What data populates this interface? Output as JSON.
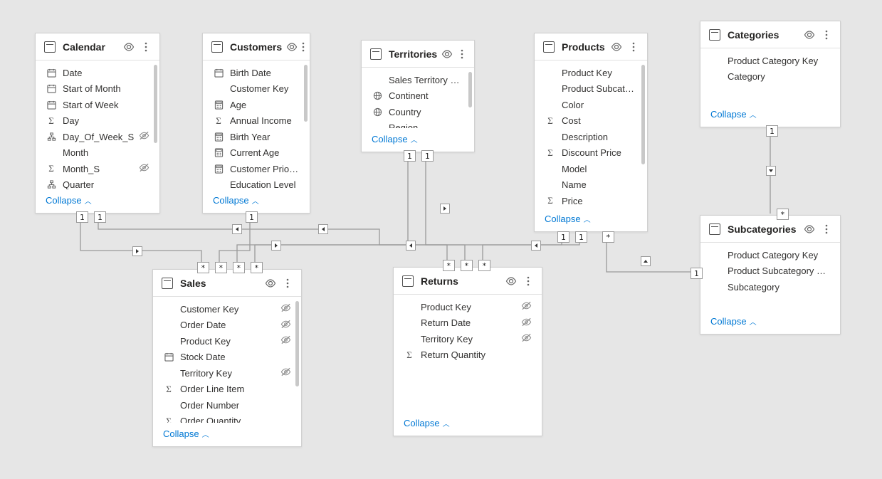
{
  "collapse_label": "Collapse",
  "chart_data": {
    "type": "diagram",
    "description": "Power BI data model relationship view",
    "tables": [
      "Calendar",
      "Customers",
      "Territories",
      "Products",
      "Categories",
      "Sales",
      "Returns",
      "Subcategories"
    ],
    "relationships": [
      {
        "from": "Calendar",
        "to": "Sales",
        "from_card": "1",
        "to_card": "*"
      },
      {
        "from": "Calendar",
        "to": "Returns",
        "from_card": "1",
        "to_card": "*"
      },
      {
        "from": "Customers",
        "to": "Sales",
        "from_card": "1",
        "to_card": "*"
      },
      {
        "from": "Territories",
        "to": "Sales",
        "from_card": "1",
        "to_card": "*"
      },
      {
        "from": "Territories",
        "to": "Returns",
        "from_card": "1",
        "to_card": "*"
      },
      {
        "from": "Products",
        "to": "Sales",
        "from_card": "1",
        "to_card": "*"
      },
      {
        "from": "Products",
        "to": "Returns",
        "from_card": "1",
        "to_card": "*"
      },
      {
        "from": "Categories",
        "to": "Subcategories",
        "from_card": "1",
        "to_card": "*"
      },
      {
        "from": "Subcategories",
        "to": "Products",
        "from_card": "1",
        "to_card": "*"
      }
    ]
  },
  "cards": {
    "calendar": {
      "title": "Calendar",
      "fields": [
        {
          "icon": "calendar",
          "label": "Date"
        },
        {
          "icon": "calendar",
          "label": "Start of Month"
        },
        {
          "icon": "calendar",
          "label": "Start of Week"
        },
        {
          "icon": "sigma",
          "label": "Day"
        },
        {
          "icon": "hier",
          "label": "Day_Of_Week_S",
          "hidden": true
        },
        {
          "icon": "",
          "label": "Month"
        },
        {
          "icon": "sigma",
          "label": "Month_S",
          "hidden": true
        },
        {
          "icon": "hier",
          "label": "Quarter"
        }
      ]
    },
    "customers": {
      "title": "Customers",
      "fields": [
        {
          "icon": "calendar",
          "label": "Birth Date"
        },
        {
          "icon": "",
          "label": "Customer Key"
        },
        {
          "icon": "calc",
          "label": "Age"
        },
        {
          "icon": "sigma",
          "label": "Annual Income"
        },
        {
          "icon": "calc",
          "label": "Birth Year"
        },
        {
          "icon": "calc",
          "label": "Current Age"
        },
        {
          "icon": "calc",
          "label": "Customer Priority"
        },
        {
          "icon": "",
          "label": "Education Level"
        }
      ]
    },
    "territories": {
      "title": "Territories",
      "fields": [
        {
          "icon": "",
          "label": "Sales Territory Key"
        },
        {
          "icon": "globe",
          "label": "Continent"
        },
        {
          "icon": "globe",
          "label": "Country"
        },
        {
          "icon": "",
          "label": "Region"
        }
      ]
    },
    "products": {
      "title": "Products",
      "fields": [
        {
          "icon": "",
          "label": "Product Key"
        },
        {
          "icon": "",
          "label": "Product Subcategor..."
        },
        {
          "icon": "",
          "label": "Color"
        },
        {
          "icon": "sigma",
          "label": "Cost"
        },
        {
          "icon": "",
          "label": "Description"
        },
        {
          "icon": "sigma",
          "label": "Discount Price"
        },
        {
          "icon": "",
          "label": "Model"
        },
        {
          "icon": "",
          "label": "Name"
        },
        {
          "icon": "sigma",
          "label": "Price"
        }
      ]
    },
    "categories": {
      "title": "Categories",
      "fields": [
        {
          "icon": "",
          "label": "Product Category Key"
        },
        {
          "icon": "",
          "label": "Category"
        }
      ]
    },
    "sales": {
      "title": "Sales",
      "fields": [
        {
          "icon": "",
          "label": "Customer Key",
          "hidden": true
        },
        {
          "icon": "",
          "label": "Order Date",
          "hidden": true
        },
        {
          "icon": "",
          "label": "Product Key",
          "hidden": true
        },
        {
          "icon": "calendar",
          "label": "Stock Date"
        },
        {
          "icon": "",
          "label": "Territory Key",
          "hidden": true
        },
        {
          "icon": "sigma",
          "label": "Order Line Item"
        },
        {
          "icon": "",
          "label": "Order Number"
        },
        {
          "icon": "sigma",
          "label": "Order Quantity"
        }
      ]
    },
    "returns": {
      "title": "Returns",
      "fields": [
        {
          "icon": "",
          "label": "Product Key",
          "hidden": true
        },
        {
          "icon": "",
          "label": "Return Date",
          "hidden": true
        },
        {
          "icon": "",
          "label": "Territory Key",
          "hidden": true
        },
        {
          "icon": "sigma",
          "label": "Return Quantity"
        }
      ]
    },
    "subcategories": {
      "title": "Subcategories",
      "fields": [
        {
          "icon": "",
          "label": "Product Category Key"
        },
        {
          "icon": "",
          "label": "Product Subcategory Key"
        },
        {
          "icon": "",
          "label": "Subcategory"
        }
      ]
    }
  }
}
